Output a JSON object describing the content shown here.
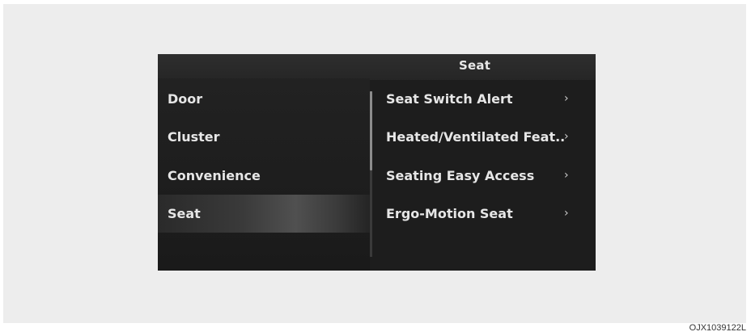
{
  "header": {
    "title": "Seat"
  },
  "left_menu": {
    "items": [
      {
        "label": "Door"
      },
      {
        "label": "Cluster"
      },
      {
        "label": "Convenience"
      },
      {
        "label": "Seat",
        "selected": true
      }
    ]
  },
  "right_menu": {
    "items": [
      {
        "label": "Seat Switch Alert",
        "chevron": "›"
      },
      {
        "label": "Heated/Ventilated Feat..",
        "chevron": "›"
      },
      {
        "label": "Seating Easy Access",
        "chevron": "›"
      },
      {
        "label": "Ergo-Motion Seat",
        "chevron": "›"
      }
    ]
  },
  "caption": "OJX1039122L"
}
